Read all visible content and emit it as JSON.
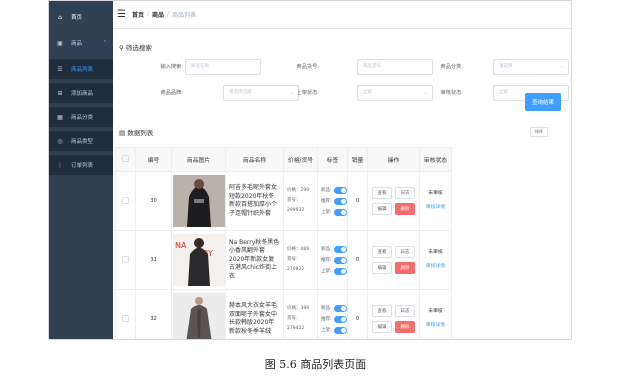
{
  "sidebar": {
    "home": "首页",
    "group": "商品",
    "items": [
      {
        "label": "商品列表",
        "icon": "list-icon"
      },
      {
        "label": "添加商品",
        "icon": "add-icon"
      },
      {
        "label": "商品分类",
        "icon": "category-icon"
      },
      {
        "label": "商品类型",
        "icon": "type-icon"
      },
      {
        "label": "订单列表",
        "icon": "order-icon"
      }
    ]
  },
  "breadcrumb": {
    "home": "首页",
    "section": "商品",
    "current": "商品列表"
  },
  "filter": {
    "title": "筛选搜索",
    "keyword_label": "输入搜索:",
    "keyword_placeholder": "商品名称",
    "sn_label": "商品货号:",
    "sn_placeholder": "商品货号",
    "category_label": "商品分类:",
    "category_placeholder": "请选择",
    "brand_label": "商品品牌:",
    "brand_placeholder": "请选择品牌",
    "publish_label": "上架状态:",
    "publish_placeholder": "全部",
    "verify_label": "审核状态:",
    "verify_placeholder": "全部",
    "search_button": "查询结果"
  },
  "list": {
    "title": "数据列表",
    "sort_button": "排序"
  },
  "table": {
    "headers": [
      "编号",
      "商品图片",
      "商品名称",
      "价格/货号",
      "标签",
      "销量",
      "操作",
      "审核状态"
    ],
    "tag_labels": [
      "新品:",
      "推荐:",
      "上架:"
    ],
    "op_labels": [
      "查看",
      "日志",
      "编辑",
      "删除"
    ],
    "verify_status": "未审核",
    "verify_link": "审核详情",
    "rows": [
      {
        "id": "30",
        "name": "阿吉多毛呢外套女短款2020年秋冬新款百搭加厚小个子连帽针织外套",
        "price": "价格：299",
        "sn": "货号：299932",
        "sales": "0"
      },
      {
        "id": "31",
        "name": "Na Berry秋冬黑色小香风翻外套2020年新款女复古港风chic炸街上衣",
        "price": "价格：489",
        "sn": "货号：270822",
        "sales": "0"
      },
      {
        "id": "32",
        "name": "赫本风大衣女羊毛双面呢子外套女中长款韩版2020年新款秋冬季羊绒",
        "price": "价格：399",
        "sn": "货号：279422",
        "sales": "0"
      }
    ]
  },
  "caption": "图 5.6  商品列表页面",
  "colors": {
    "sidebar": "#304156",
    "primary": "#409eff",
    "danger": "#f56c6c"
  }
}
